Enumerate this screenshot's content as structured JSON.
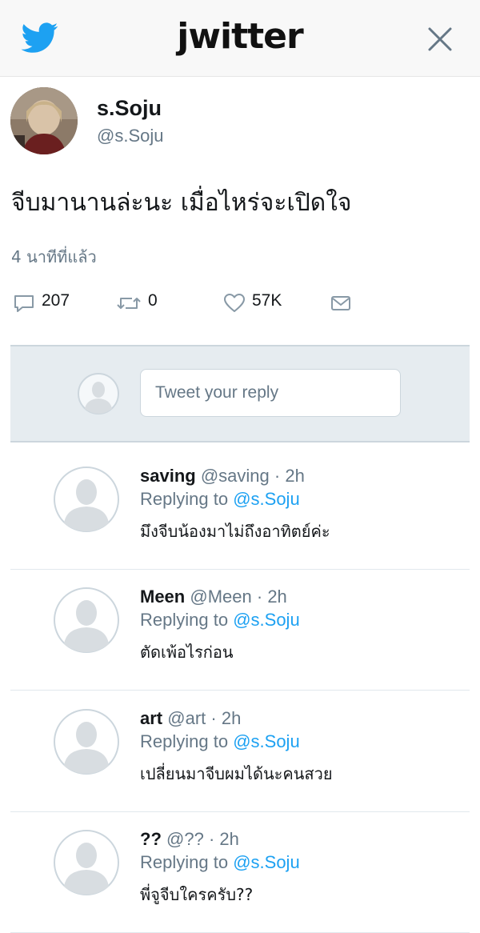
{
  "header": {
    "logo_text": "jwitter",
    "bird_icon": "twitter-bird-icon",
    "close_icon": "close-icon",
    "brand_color": "#1da1f2"
  },
  "tweet": {
    "display_name": "s.Soju",
    "handle": "@s.Soju",
    "text": "จีบมานานล่ะนะ เมื่อไหร่จะเปิดใจ",
    "time": "4 นาทีที่แล้ว",
    "actions": {
      "reply_count": "207",
      "retweet_count": "0",
      "like_count": "57K"
    }
  },
  "reply_composer": {
    "placeholder": "Tweet your reply"
  },
  "replies": [
    {
      "name": "saving",
      "handle": "@saving",
      "time": "2h",
      "replying_prefix": "Replying to",
      "replying_to": "@s.Soju",
      "text": "มึงจีบน้องมาไม่ถึงอาทิตย์ค่ะ"
    },
    {
      "name": "Meen",
      "handle": "@Meen",
      "time": "2h",
      "replying_prefix": "Replying to",
      "replying_to": "@s.Soju",
      "text": "ตัดเพ้อไรก่อน"
    },
    {
      "name": "art",
      "handle": "@art",
      "time": "2h",
      "replying_prefix": "Replying to",
      "replying_to": "@s.Soju",
      "text": "เปลี่ยนมาจีบผมได้นะคนสวย"
    },
    {
      "name": "??",
      "handle": "@??",
      "time": "2h",
      "replying_prefix": "Replying to",
      "replying_to": "@s.Soju",
      "text": "พี่จูจีบใครครับ??"
    }
  ]
}
